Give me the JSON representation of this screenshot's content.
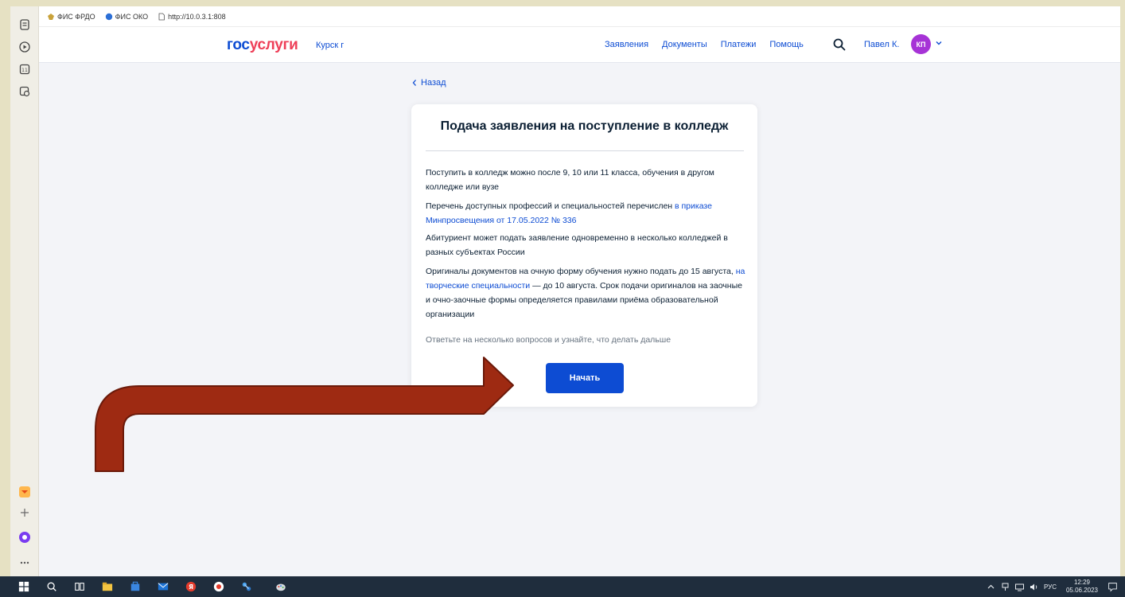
{
  "bookmarks": [
    {
      "label": "ФИС ФРДО",
      "icon": "emblem-icon"
    },
    {
      "label": "ФИС ОКО",
      "icon": "globe-icon"
    },
    {
      "label": "http://10.0.3.1:808",
      "icon": "page-icon"
    }
  ],
  "header": {
    "logo_part1": "гос",
    "logo_part2": "услуги",
    "region": "Курск г",
    "nav": [
      "Заявления",
      "Документы",
      "Платежи",
      "Помощь"
    ],
    "user_name": "Павел К.",
    "avatar_initials": "КП"
  },
  "back_label": "Назад",
  "card": {
    "title": "Подача заявления на поступление в колледж",
    "p1": "Поступить в колледж можно после 9, 10 или 11 класса, обучения в другом колледже или вузе",
    "p2_text": "Перечень доступных профессий и специальностей перечислен ",
    "p2_link": "в приказе Минпросвещения от 17.05.2022 № 336",
    "p3": "Абитуриент может подать заявление одновременно в несколько колледжей в разных субъектах России",
    "p4_a": "Оригиналы документов на очную форму обучения нужно подать до 15 августа, ",
    "p4_link": "на творческие специальности",
    "p4_b": " — до 10 августа. Срок подачи оригиналов на заочные и очно-заочные формы определяется правилами приёма образовательной организации",
    "hint": "Ответьте на несколько вопросов и узнайте, что делать дальше",
    "start_button": "Начать"
  },
  "taskbar": {
    "lang": "РУС",
    "time": "12:29",
    "date": "05.06.2023"
  },
  "colors": {
    "brand_blue": "#0d4cd3",
    "brand_red": "#ee3f58",
    "avatar": "#a633d6",
    "arrow_fill": "#9e2a12",
    "arrow_stroke": "#6b1a0a"
  }
}
